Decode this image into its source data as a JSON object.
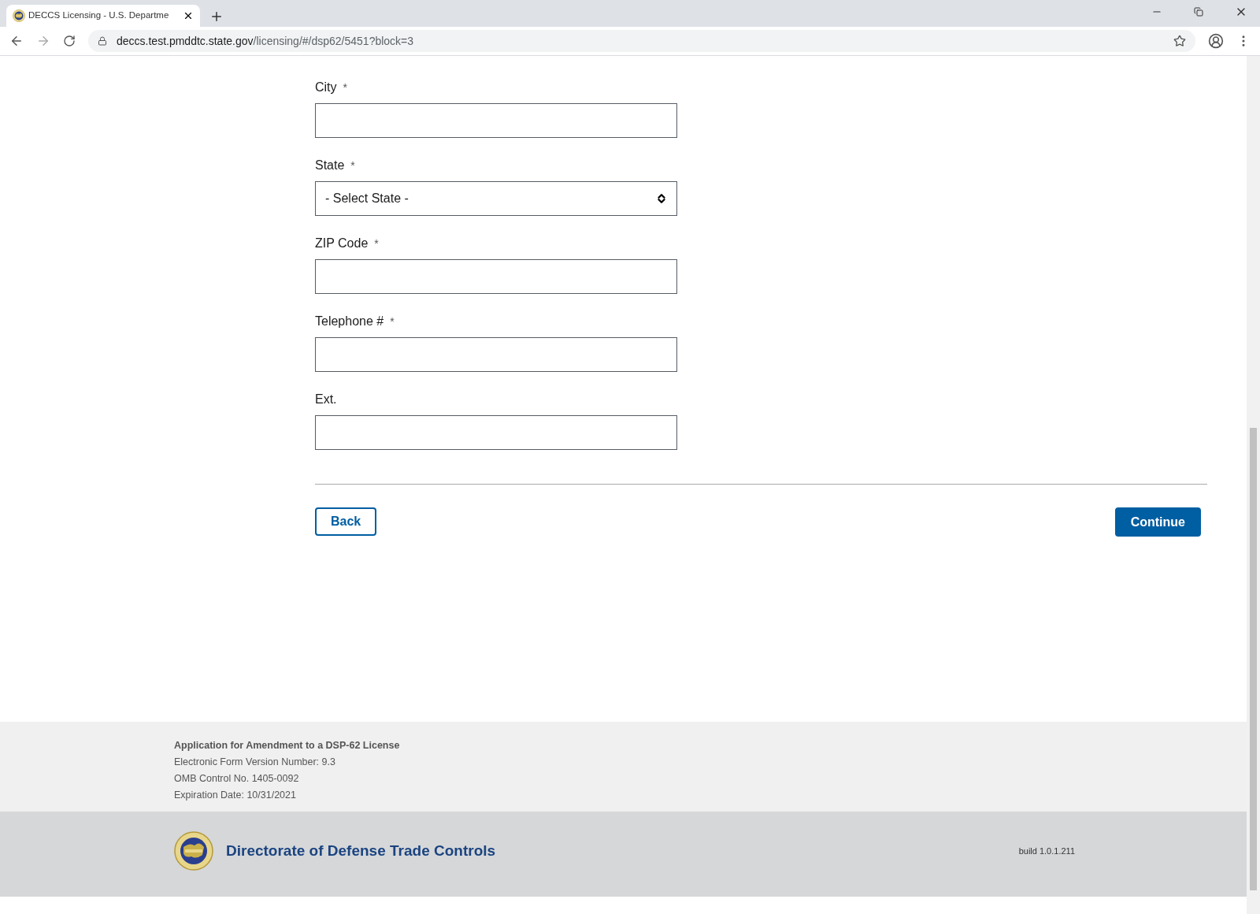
{
  "browser": {
    "tab_title": "DECCS Licensing - U.S. Departme",
    "url_host": "deccs.test.pmddtc.state.gov",
    "url_path": "/licensing/#/dsp62/5451?block=3"
  },
  "form": {
    "fields": [
      {
        "kind": "text",
        "label": "City",
        "required": true
      },
      {
        "kind": "select",
        "label": "State",
        "required": true,
        "value": "- Select State -"
      },
      {
        "kind": "text",
        "label": "ZIP Code",
        "required": true
      },
      {
        "kind": "text",
        "label": "Telephone #",
        "required": true
      },
      {
        "kind": "text",
        "label": "Ext.",
        "required": false
      }
    ],
    "required_mark": "*",
    "back_button": "Back",
    "continue_button": "Continue"
  },
  "footer": {
    "title": "Application for Amendment to a DSP-62 License",
    "lines": [
      "Electronic Form Version Number: 9.3",
      "OMB Control No. 1405-0092",
      "Expiration Date: 10/31/2021"
    ],
    "agency": "Directorate of Defense Trade Controls",
    "build": "build 1.0.1.211"
  }
}
